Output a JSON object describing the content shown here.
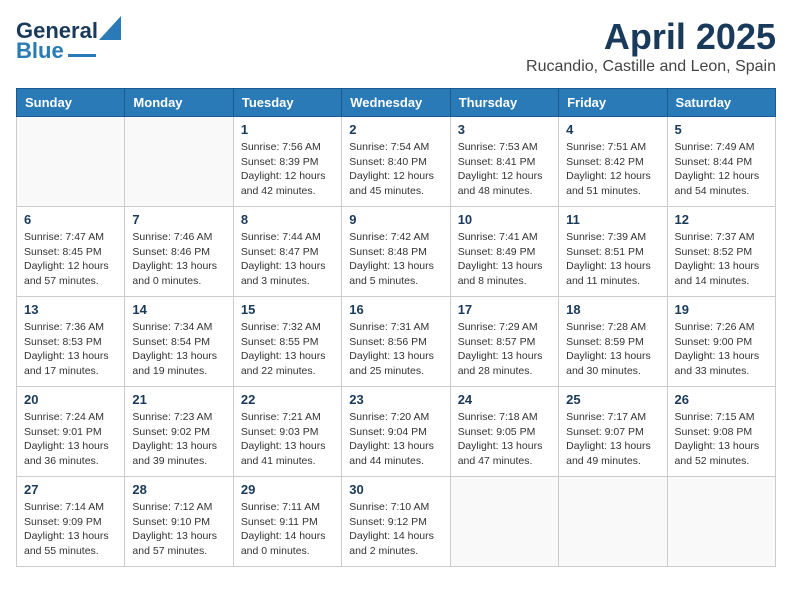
{
  "header": {
    "logo_general": "General",
    "logo_blue": "Blue",
    "title": "April 2025",
    "subtitle": "Rucandio, Castille and Leon, Spain"
  },
  "weekdays": [
    "Sunday",
    "Monday",
    "Tuesday",
    "Wednesday",
    "Thursday",
    "Friday",
    "Saturday"
  ],
  "weeks": [
    [
      {
        "day": "",
        "sunrise": "",
        "sunset": "",
        "daylight": ""
      },
      {
        "day": "",
        "sunrise": "",
        "sunset": "",
        "daylight": ""
      },
      {
        "day": "1",
        "sunrise": "Sunrise: 7:56 AM",
        "sunset": "Sunset: 8:39 PM",
        "daylight": "Daylight: 12 hours and 42 minutes."
      },
      {
        "day": "2",
        "sunrise": "Sunrise: 7:54 AM",
        "sunset": "Sunset: 8:40 PM",
        "daylight": "Daylight: 12 hours and 45 minutes."
      },
      {
        "day": "3",
        "sunrise": "Sunrise: 7:53 AM",
        "sunset": "Sunset: 8:41 PM",
        "daylight": "Daylight: 12 hours and 48 minutes."
      },
      {
        "day": "4",
        "sunrise": "Sunrise: 7:51 AM",
        "sunset": "Sunset: 8:42 PM",
        "daylight": "Daylight: 12 hours and 51 minutes."
      },
      {
        "day": "5",
        "sunrise": "Sunrise: 7:49 AM",
        "sunset": "Sunset: 8:44 PM",
        "daylight": "Daylight: 12 hours and 54 minutes."
      }
    ],
    [
      {
        "day": "6",
        "sunrise": "Sunrise: 7:47 AM",
        "sunset": "Sunset: 8:45 PM",
        "daylight": "Daylight: 12 hours and 57 minutes."
      },
      {
        "day": "7",
        "sunrise": "Sunrise: 7:46 AM",
        "sunset": "Sunset: 8:46 PM",
        "daylight": "Daylight: 13 hours and 0 minutes."
      },
      {
        "day": "8",
        "sunrise": "Sunrise: 7:44 AM",
        "sunset": "Sunset: 8:47 PM",
        "daylight": "Daylight: 13 hours and 3 minutes."
      },
      {
        "day": "9",
        "sunrise": "Sunrise: 7:42 AM",
        "sunset": "Sunset: 8:48 PM",
        "daylight": "Daylight: 13 hours and 5 minutes."
      },
      {
        "day": "10",
        "sunrise": "Sunrise: 7:41 AM",
        "sunset": "Sunset: 8:49 PM",
        "daylight": "Daylight: 13 hours and 8 minutes."
      },
      {
        "day": "11",
        "sunrise": "Sunrise: 7:39 AM",
        "sunset": "Sunset: 8:51 PM",
        "daylight": "Daylight: 13 hours and 11 minutes."
      },
      {
        "day": "12",
        "sunrise": "Sunrise: 7:37 AM",
        "sunset": "Sunset: 8:52 PM",
        "daylight": "Daylight: 13 hours and 14 minutes."
      }
    ],
    [
      {
        "day": "13",
        "sunrise": "Sunrise: 7:36 AM",
        "sunset": "Sunset: 8:53 PM",
        "daylight": "Daylight: 13 hours and 17 minutes."
      },
      {
        "day": "14",
        "sunrise": "Sunrise: 7:34 AM",
        "sunset": "Sunset: 8:54 PM",
        "daylight": "Daylight: 13 hours and 19 minutes."
      },
      {
        "day": "15",
        "sunrise": "Sunrise: 7:32 AM",
        "sunset": "Sunset: 8:55 PM",
        "daylight": "Daylight: 13 hours and 22 minutes."
      },
      {
        "day": "16",
        "sunrise": "Sunrise: 7:31 AM",
        "sunset": "Sunset: 8:56 PM",
        "daylight": "Daylight: 13 hours and 25 minutes."
      },
      {
        "day": "17",
        "sunrise": "Sunrise: 7:29 AM",
        "sunset": "Sunset: 8:57 PM",
        "daylight": "Daylight: 13 hours and 28 minutes."
      },
      {
        "day": "18",
        "sunrise": "Sunrise: 7:28 AM",
        "sunset": "Sunset: 8:59 PM",
        "daylight": "Daylight: 13 hours and 30 minutes."
      },
      {
        "day": "19",
        "sunrise": "Sunrise: 7:26 AM",
        "sunset": "Sunset: 9:00 PM",
        "daylight": "Daylight: 13 hours and 33 minutes."
      }
    ],
    [
      {
        "day": "20",
        "sunrise": "Sunrise: 7:24 AM",
        "sunset": "Sunset: 9:01 PM",
        "daylight": "Daylight: 13 hours and 36 minutes."
      },
      {
        "day": "21",
        "sunrise": "Sunrise: 7:23 AM",
        "sunset": "Sunset: 9:02 PM",
        "daylight": "Daylight: 13 hours and 39 minutes."
      },
      {
        "day": "22",
        "sunrise": "Sunrise: 7:21 AM",
        "sunset": "Sunset: 9:03 PM",
        "daylight": "Daylight: 13 hours and 41 minutes."
      },
      {
        "day": "23",
        "sunrise": "Sunrise: 7:20 AM",
        "sunset": "Sunset: 9:04 PM",
        "daylight": "Daylight: 13 hours and 44 minutes."
      },
      {
        "day": "24",
        "sunrise": "Sunrise: 7:18 AM",
        "sunset": "Sunset: 9:05 PM",
        "daylight": "Daylight: 13 hours and 47 minutes."
      },
      {
        "day": "25",
        "sunrise": "Sunrise: 7:17 AM",
        "sunset": "Sunset: 9:07 PM",
        "daylight": "Daylight: 13 hours and 49 minutes."
      },
      {
        "day": "26",
        "sunrise": "Sunrise: 7:15 AM",
        "sunset": "Sunset: 9:08 PM",
        "daylight": "Daylight: 13 hours and 52 minutes."
      }
    ],
    [
      {
        "day": "27",
        "sunrise": "Sunrise: 7:14 AM",
        "sunset": "Sunset: 9:09 PM",
        "daylight": "Daylight: 13 hours and 55 minutes."
      },
      {
        "day": "28",
        "sunrise": "Sunrise: 7:12 AM",
        "sunset": "Sunset: 9:10 PM",
        "daylight": "Daylight: 13 hours and 57 minutes."
      },
      {
        "day": "29",
        "sunrise": "Sunrise: 7:11 AM",
        "sunset": "Sunset: 9:11 PM",
        "daylight": "Daylight: 14 hours and 0 minutes."
      },
      {
        "day": "30",
        "sunrise": "Sunrise: 7:10 AM",
        "sunset": "Sunset: 9:12 PM",
        "daylight": "Daylight: 14 hours and 2 minutes."
      },
      {
        "day": "",
        "sunrise": "",
        "sunset": "",
        "daylight": ""
      },
      {
        "day": "",
        "sunrise": "",
        "sunset": "",
        "daylight": ""
      },
      {
        "day": "",
        "sunrise": "",
        "sunset": "",
        "daylight": ""
      }
    ]
  ]
}
